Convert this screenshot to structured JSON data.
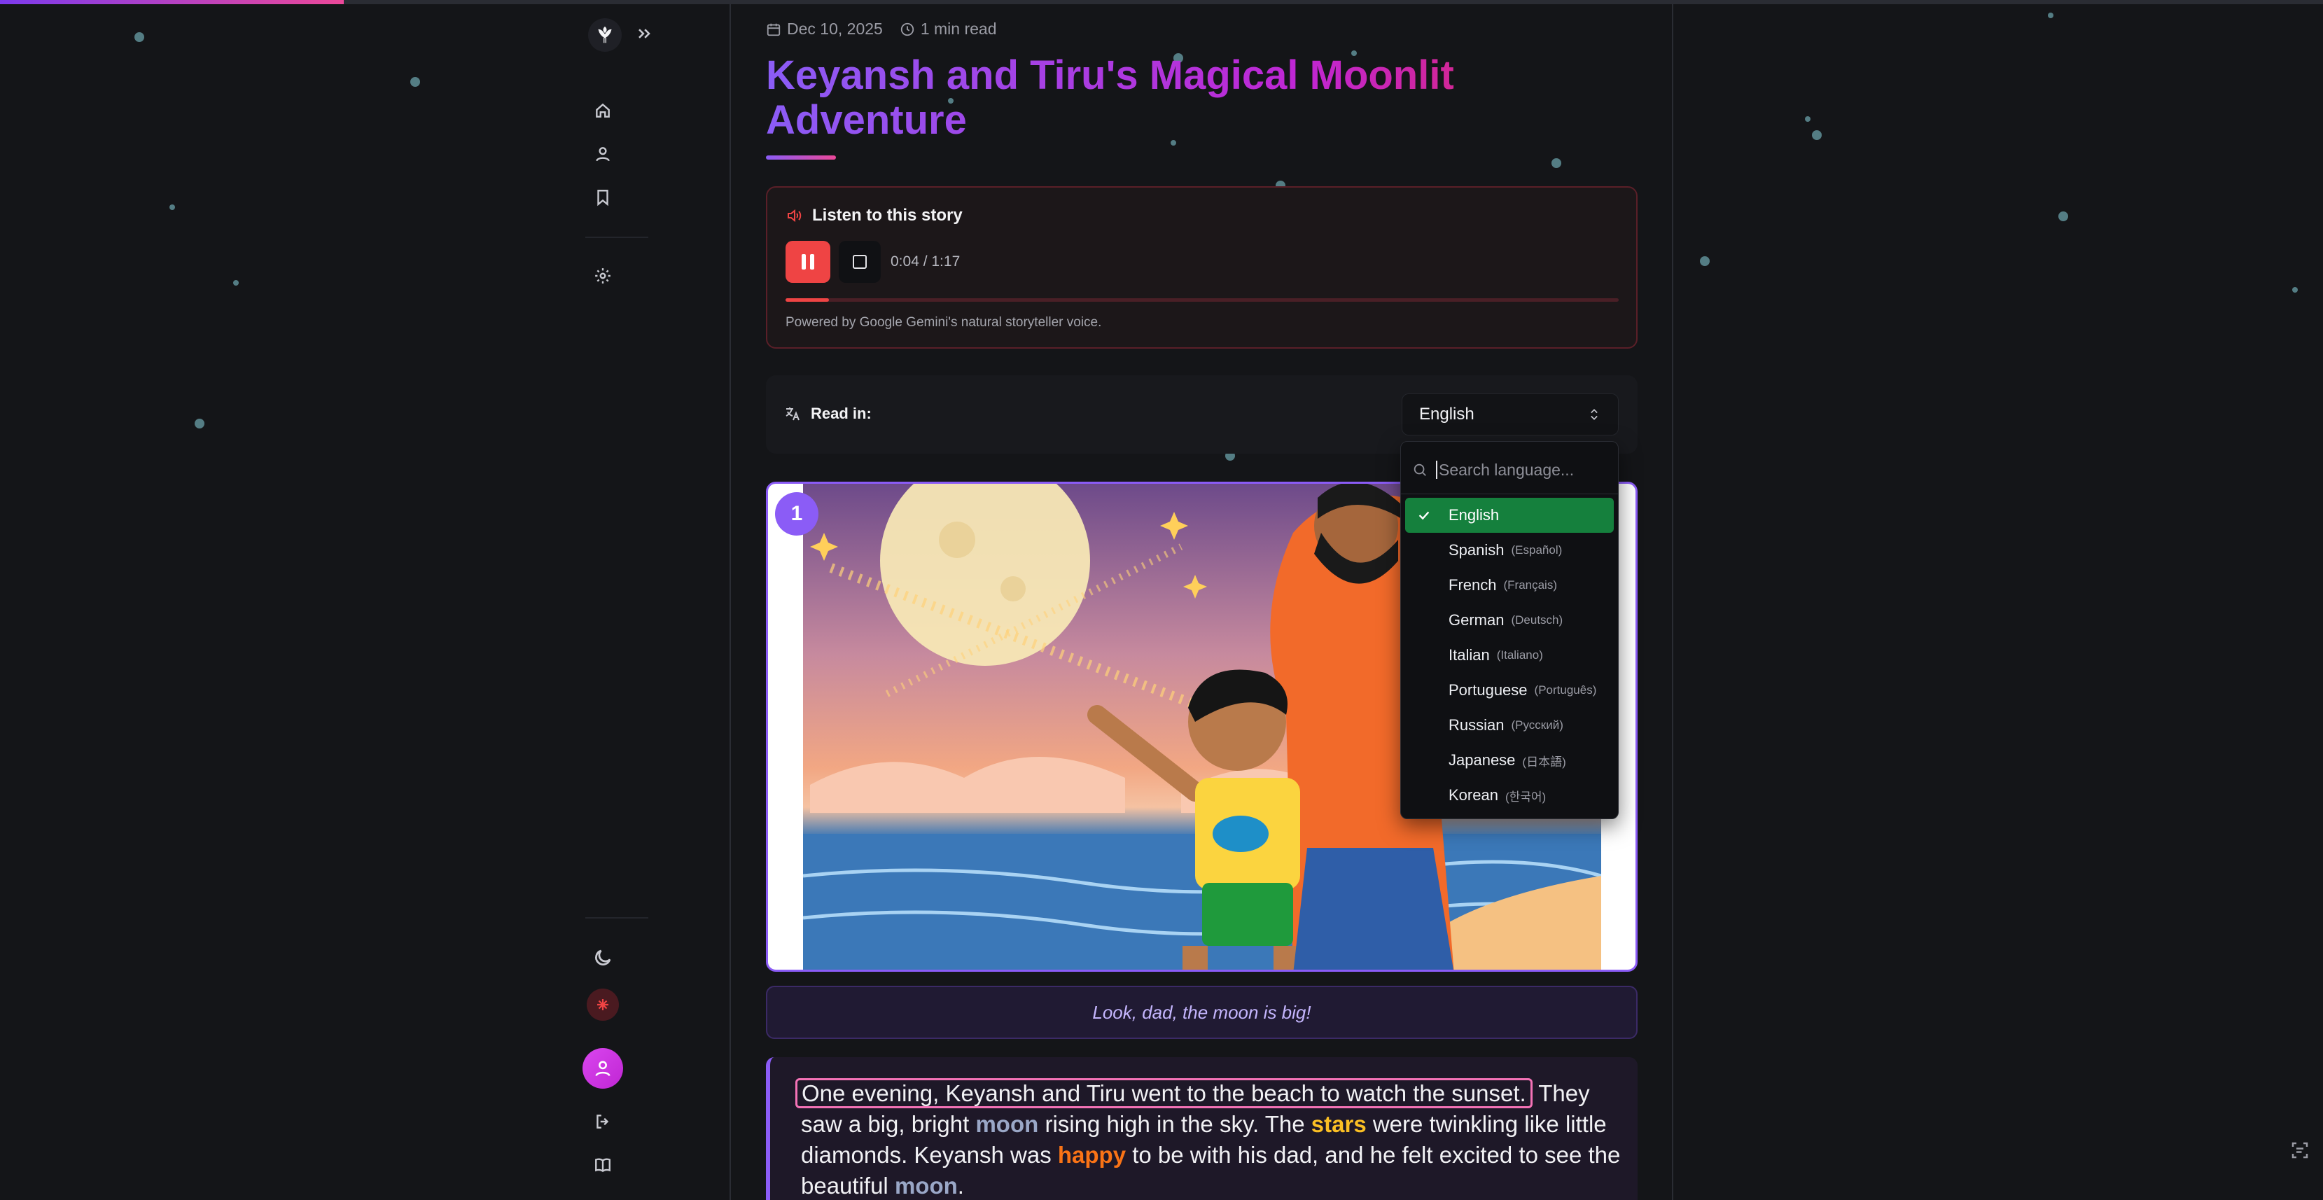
{
  "reading_progress": 0.148,
  "sidebar": {
    "logo_icon": "tiru-logo-icon",
    "collapse_icon": "chevrons-right-icon",
    "nav": [
      "home-icon",
      "user-icon",
      "bookmark-icon"
    ],
    "settings_icon": "gear-icon",
    "footer": [
      "moon-icon",
      "app-badge-icon",
      "avatar",
      "logout-icon",
      "book-icon"
    ]
  },
  "article": {
    "date": "Dec 10, 2025",
    "read_time": "1 min read",
    "title": "Keyansh and Tiru's Magical Moonlit Adventure"
  },
  "audio": {
    "heading": "Listen to this story",
    "time": "0:04 / 1:17",
    "progress": 0.0519,
    "powered_by": "Powered by Google Gemini's natural storyteller voice.",
    "accent": "#ef4444"
  },
  "language": {
    "label": "Read in:",
    "selected": "English",
    "search_placeholder": "Search language...",
    "options": [
      {
        "name": "English",
        "native": ""
      },
      {
        "name": "Spanish",
        "native": "(Español)"
      },
      {
        "name": "French",
        "native": "(Français)"
      },
      {
        "name": "German",
        "native": "(Deutsch)"
      },
      {
        "name": "Italian",
        "native": "(Italiano)"
      },
      {
        "name": "Portuguese",
        "native": "(Português)"
      },
      {
        "name": "Russian",
        "native": "(Русский)"
      },
      {
        "name": "Japanese",
        "native": "(日本語)"
      },
      {
        "name": "Korean",
        "native": "(한국어)"
      }
    ],
    "selected_color": "#15803d"
  },
  "page": {
    "number": "1",
    "caption": "Look, dad, the moon is big!",
    "story": {
      "s1": "One evening, Keyansh and Tiru went to the beach to watch the sunset.",
      "s2a": " They saw a big, bright ",
      "moon": "moon",
      "s2b": " rising high in the sky. The ",
      "stars": "stars",
      "s2c": " were twinkling like little diamonds. Keyansh was ",
      "happy": "happy",
      "s2d": " to be with his dad, and he felt excited to see the beautiful ",
      "moon2": "moon",
      "s2e": "."
    }
  }
}
